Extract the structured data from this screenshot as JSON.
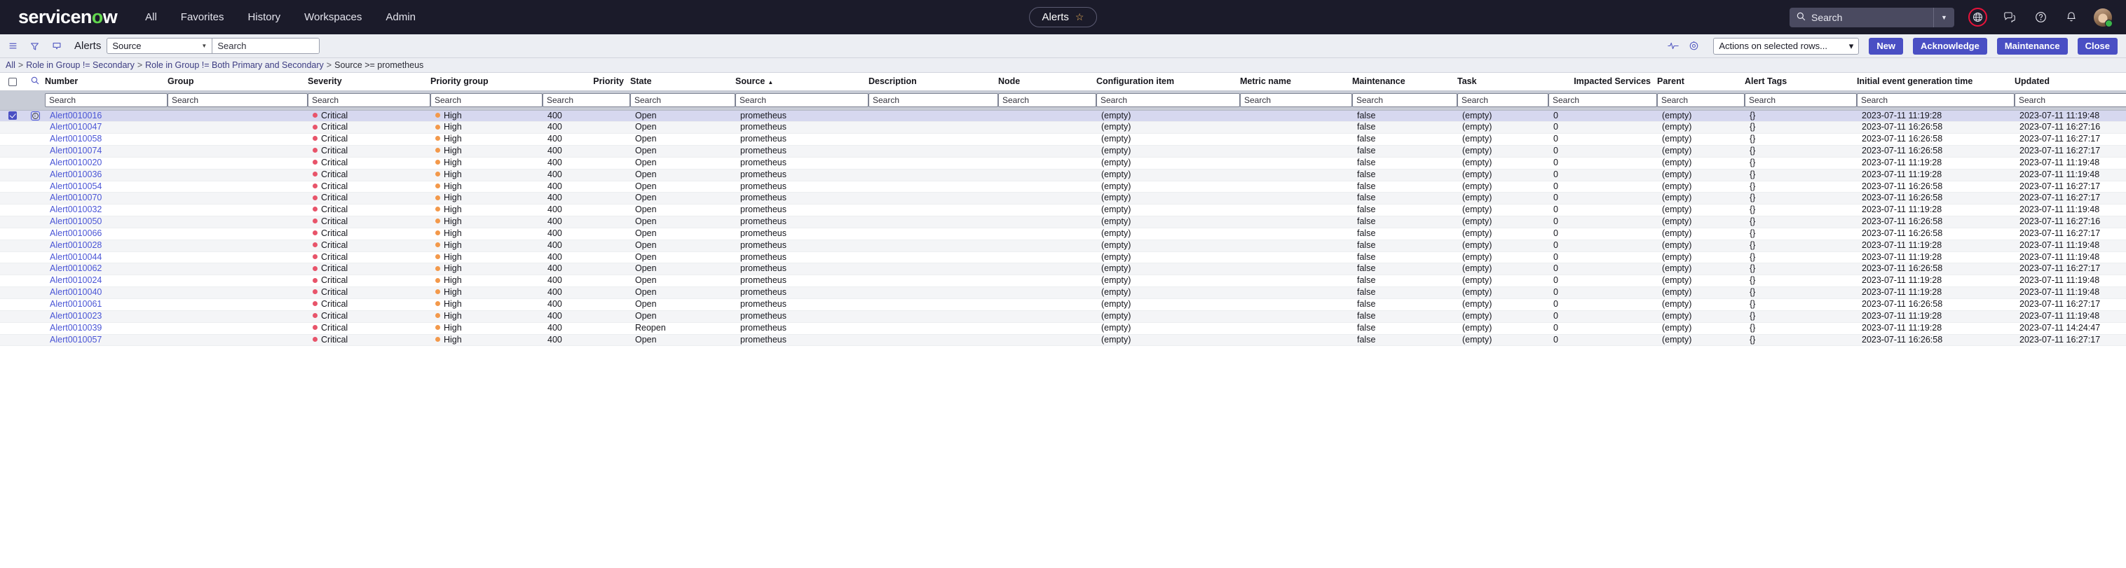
{
  "topnav": {
    "logo": "servicenow",
    "links": [
      "All",
      "Favorites",
      "History",
      "Workspaces",
      "Admin"
    ],
    "center_tab": {
      "label": "Alerts",
      "star_icon": "star-outline-icon"
    },
    "search": {
      "placeholder": "Search",
      "value": "Search"
    },
    "icons": [
      "globe-icon",
      "conversations-icon",
      "help-icon",
      "notifications-bell-icon",
      "user-avatar"
    ]
  },
  "toolbar": {
    "menu_icon": "list-menu-icon",
    "filter_icon": "funnel-filter-icon",
    "comment_icon": "comment-icon",
    "title": "Alerts",
    "field_select": "Source",
    "search_placeholder": "Search",
    "search_value": "",
    "insights_icon": "activity-stream-icon",
    "settings_icon": "gear-icon",
    "actions_select": "Actions on selected rows...",
    "buttons": [
      "New",
      "Acknowledge",
      "Maintenance",
      "Close"
    ]
  },
  "breadcrumb": {
    "segments": [
      "All",
      "Role in Group != Secondary",
      "Role in Group != Both Primary and Secondary",
      "Source >= prometheus"
    ],
    "separator": ">"
  },
  "table": {
    "columns": [
      "Number",
      "Group",
      "Severity",
      "Priority group",
      "Priority",
      "State",
      "Source",
      "Description",
      "Node",
      "Configuration item",
      "Metric name",
      "Maintenance",
      "Task",
      "Impacted Services",
      "Parent",
      "Alert Tags",
      "Initial event generation time",
      "Updated"
    ],
    "sorted_column": "Source",
    "sort_direction": "asc",
    "search_placeholder": "Search",
    "rows": [
      {
        "selected": true,
        "number": "Alert0010016",
        "group": "",
        "severity": "Critical",
        "priority_group": "High",
        "priority": "400",
        "state": "Open",
        "source": "prometheus",
        "description": "",
        "node": "",
        "configuration_item": "(empty)",
        "metric_name": "",
        "maintenance": "false",
        "task": "(empty)",
        "impacted_services": "0",
        "parent": "(empty)",
        "alert_tags": "{}",
        "initial_event_generation_time": "2023-07-11 11:19:28",
        "updated": "2023-07-11 11:19:48"
      },
      {
        "selected": false,
        "number": "Alert0010047",
        "group": "",
        "severity": "Critical",
        "priority_group": "High",
        "priority": "400",
        "state": "Open",
        "source": "prometheus",
        "description": "",
        "node": "",
        "configuration_item": "(empty)",
        "metric_name": "",
        "maintenance": "false",
        "task": "(empty)",
        "impacted_services": "0",
        "parent": "(empty)",
        "alert_tags": "{}",
        "initial_event_generation_time": "2023-07-11 16:26:58",
        "updated": "2023-07-11 16:27:16"
      },
      {
        "selected": false,
        "number": "Alert0010058",
        "group": "",
        "severity": "Critical",
        "priority_group": "High",
        "priority": "400",
        "state": "Open",
        "source": "prometheus",
        "description": "",
        "node": "",
        "configuration_item": "(empty)",
        "metric_name": "",
        "maintenance": "false",
        "task": "(empty)",
        "impacted_services": "0",
        "parent": "(empty)",
        "alert_tags": "{}",
        "initial_event_generation_time": "2023-07-11 16:26:58",
        "updated": "2023-07-11 16:27:17"
      },
      {
        "selected": false,
        "number": "Alert0010074",
        "group": "",
        "severity": "Critical",
        "priority_group": "High",
        "priority": "400",
        "state": "Open",
        "source": "prometheus",
        "description": "",
        "node": "",
        "configuration_item": "(empty)",
        "metric_name": "",
        "maintenance": "false",
        "task": "(empty)",
        "impacted_services": "0",
        "parent": "(empty)",
        "alert_tags": "{}",
        "initial_event_generation_time": "2023-07-11 16:26:58",
        "updated": "2023-07-11 16:27:17"
      },
      {
        "selected": false,
        "number": "Alert0010020",
        "group": "",
        "severity": "Critical",
        "priority_group": "High",
        "priority": "400",
        "state": "Open",
        "source": "prometheus",
        "description": "",
        "node": "",
        "configuration_item": "(empty)",
        "metric_name": "",
        "maintenance": "false",
        "task": "(empty)",
        "impacted_services": "0",
        "parent": "(empty)",
        "alert_tags": "{}",
        "initial_event_generation_time": "2023-07-11 11:19:28",
        "updated": "2023-07-11 11:19:48"
      },
      {
        "selected": false,
        "number": "Alert0010036",
        "group": "",
        "severity": "Critical",
        "priority_group": "High",
        "priority": "400",
        "state": "Open",
        "source": "prometheus",
        "description": "",
        "node": "",
        "configuration_item": "(empty)",
        "metric_name": "",
        "maintenance": "false",
        "task": "(empty)",
        "impacted_services": "0",
        "parent": "(empty)",
        "alert_tags": "{}",
        "initial_event_generation_time": "2023-07-11 11:19:28",
        "updated": "2023-07-11 11:19:48"
      },
      {
        "selected": false,
        "number": "Alert0010054",
        "group": "",
        "severity": "Critical",
        "priority_group": "High",
        "priority": "400",
        "state": "Open",
        "source": "prometheus",
        "description": "",
        "node": "",
        "configuration_item": "(empty)",
        "metric_name": "",
        "maintenance": "false",
        "task": "(empty)",
        "impacted_services": "0",
        "parent": "(empty)",
        "alert_tags": "{}",
        "initial_event_generation_time": "2023-07-11 16:26:58",
        "updated": "2023-07-11 16:27:17"
      },
      {
        "selected": false,
        "number": "Alert0010070",
        "group": "",
        "severity": "Critical",
        "priority_group": "High",
        "priority": "400",
        "state": "Open",
        "source": "prometheus",
        "description": "",
        "node": "",
        "configuration_item": "(empty)",
        "metric_name": "",
        "maintenance": "false",
        "task": "(empty)",
        "impacted_services": "0",
        "parent": "(empty)",
        "alert_tags": "{}",
        "initial_event_generation_time": "2023-07-11 16:26:58",
        "updated": "2023-07-11 16:27:17"
      },
      {
        "selected": false,
        "number": "Alert0010032",
        "group": "",
        "severity": "Critical",
        "priority_group": "High",
        "priority": "400",
        "state": "Open",
        "source": "prometheus",
        "description": "",
        "node": "",
        "configuration_item": "(empty)",
        "metric_name": "",
        "maintenance": "false",
        "task": "(empty)",
        "impacted_services": "0",
        "parent": "(empty)",
        "alert_tags": "{}",
        "initial_event_generation_time": "2023-07-11 11:19:28",
        "updated": "2023-07-11 11:19:48"
      },
      {
        "selected": false,
        "number": "Alert0010050",
        "group": "",
        "severity": "Critical",
        "priority_group": "High",
        "priority": "400",
        "state": "Open",
        "source": "prometheus",
        "description": "",
        "node": "",
        "configuration_item": "(empty)",
        "metric_name": "",
        "maintenance": "false",
        "task": "(empty)",
        "impacted_services": "0",
        "parent": "(empty)",
        "alert_tags": "{}",
        "initial_event_generation_time": "2023-07-11 16:26:58",
        "updated": "2023-07-11 16:27:16"
      },
      {
        "selected": false,
        "number": "Alert0010066",
        "group": "",
        "severity": "Critical",
        "priority_group": "High",
        "priority": "400",
        "state": "Open",
        "source": "prometheus",
        "description": "",
        "node": "",
        "configuration_item": "(empty)",
        "metric_name": "",
        "maintenance": "false",
        "task": "(empty)",
        "impacted_services": "0",
        "parent": "(empty)",
        "alert_tags": "{}",
        "initial_event_generation_time": "2023-07-11 16:26:58",
        "updated": "2023-07-11 16:27:17"
      },
      {
        "selected": false,
        "number": "Alert0010028",
        "group": "",
        "severity": "Critical",
        "priority_group": "High",
        "priority": "400",
        "state": "Open",
        "source": "prometheus",
        "description": "",
        "node": "",
        "configuration_item": "(empty)",
        "metric_name": "",
        "maintenance": "false",
        "task": "(empty)",
        "impacted_services": "0",
        "parent": "(empty)",
        "alert_tags": "{}",
        "initial_event_generation_time": "2023-07-11 11:19:28",
        "updated": "2023-07-11 11:19:48"
      },
      {
        "selected": false,
        "number": "Alert0010044",
        "group": "",
        "severity": "Critical",
        "priority_group": "High",
        "priority": "400",
        "state": "Open",
        "source": "prometheus",
        "description": "",
        "node": "",
        "configuration_item": "(empty)",
        "metric_name": "",
        "maintenance": "false",
        "task": "(empty)",
        "impacted_services": "0",
        "parent": "(empty)",
        "alert_tags": "{}",
        "initial_event_generation_time": "2023-07-11 11:19:28",
        "updated": "2023-07-11 11:19:48"
      },
      {
        "selected": false,
        "number": "Alert0010062",
        "group": "",
        "severity": "Critical",
        "priority_group": "High",
        "priority": "400",
        "state": "Open",
        "source": "prometheus",
        "description": "",
        "node": "",
        "configuration_item": "(empty)",
        "metric_name": "",
        "maintenance": "false",
        "task": "(empty)",
        "impacted_services": "0",
        "parent": "(empty)",
        "alert_tags": "{}",
        "initial_event_generation_time": "2023-07-11 16:26:58",
        "updated": "2023-07-11 16:27:17"
      },
      {
        "selected": false,
        "number": "Alert0010024",
        "group": "",
        "severity": "Critical",
        "priority_group": "High",
        "priority": "400",
        "state": "Open",
        "source": "prometheus",
        "description": "",
        "node": "",
        "configuration_item": "(empty)",
        "metric_name": "",
        "maintenance": "false",
        "task": "(empty)",
        "impacted_services": "0",
        "parent": "(empty)",
        "alert_tags": "{}",
        "initial_event_generation_time": "2023-07-11 11:19:28",
        "updated": "2023-07-11 11:19:48"
      },
      {
        "selected": false,
        "number": "Alert0010040",
        "group": "",
        "severity": "Critical",
        "priority_group": "High",
        "priority": "400",
        "state": "Open",
        "source": "prometheus",
        "description": "",
        "node": "",
        "configuration_item": "(empty)",
        "metric_name": "",
        "maintenance": "false",
        "task": "(empty)",
        "impacted_services": "0",
        "parent": "(empty)",
        "alert_tags": "{}",
        "initial_event_generation_time": "2023-07-11 11:19:28",
        "updated": "2023-07-11 11:19:48"
      },
      {
        "selected": false,
        "number": "Alert0010061",
        "group": "",
        "severity": "Critical",
        "priority_group": "High",
        "priority": "400",
        "state": "Open",
        "source": "prometheus",
        "description": "",
        "node": "",
        "configuration_item": "(empty)",
        "metric_name": "",
        "maintenance": "false",
        "task": "(empty)",
        "impacted_services": "0",
        "parent": "(empty)",
        "alert_tags": "{}",
        "initial_event_generation_time": "2023-07-11 16:26:58",
        "updated": "2023-07-11 16:27:17"
      },
      {
        "selected": false,
        "number": "Alert0010023",
        "group": "",
        "severity": "Critical",
        "priority_group": "High",
        "priority": "400",
        "state": "Open",
        "source": "prometheus",
        "description": "",
        "node": "",
        "configuration_item": "(empty)",
        "metric_name": "",
        "maintenance": "false",
        "task": "(empty)",
        "impacted_services": "0",
        "parent": "(empty)",
        "alert_tags": "{}",
        "initial_event_generation_time": "2023-07-11 11:19:28",
        "updated": "2023-07-11 11:19:48"
      },
      {
        "selected": false,
        "number": "Alert0010039",
        "group": "",
        "severity": "Critical",
        "priority_group": "High",
        "priority": "400",
        "state": "Reopen",
        "source": "prometheus",
        "description": "",
        "node": "",
        "configuration_item": "(empty)",
        "metric_name": "",
        "maintenance": "false",
        "task": "(empty)",
        "impacted_services": "0",
        "parent": "(empty)",
        "alert_tags": "{}",
        "initial_event_generation_time": "2023-07-11 11:19:28",
        "updated": "2023-07-11 14:24:47"
      },
      {
        "selected": false,
        "number": "Alert0010057",
        "group": "",
        "severity": "Critical",
        "priority_group": "High",
        "priority": "400",
        "state": "Open",
        "source": "prometheus",
        "description": "",
        "node": "",
        "configuration_item": "(empty)",
        "metric_name": "",
        "maintenance": "false",
        "task": "(empty)",
        "impacted_services": "0",
        "parent": "(empty)",
        "alert_tags": "{}",
        "initial_event_generation_time": "2023-07-11 16:26:58",
        "updated": "2023-07-11 16:27:17"
      }
    ]
  },
  "colors": {
    "nav_bg": "#1b1b2a",
    "accent": "#4a4fc4",
    "link": "#4a55d6",
    "critical": "#e8546a",
    "high": "#f3994b",
    "selected_row": "#d6d8ef"
  }
}
